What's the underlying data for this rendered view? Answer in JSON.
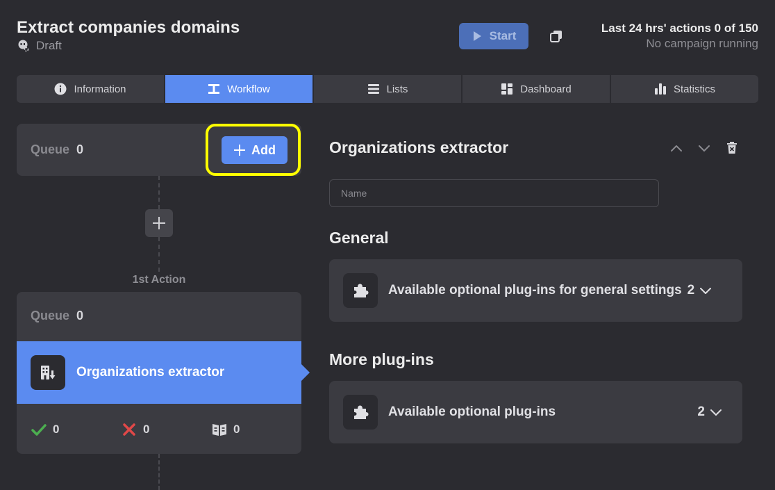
{
  "header": {
    "title": "Extract companies domains",
    "status": "Draft",
    "start_label": "Start",
    "actions_line1": "Last 24 hrs' actions 0 of 150",
    "actions_line2": "No campaign running"
  },
  "tabs": [
    {
      "label": "Information",
      "icon": "info-icon",
      "active": false
    },
    {
      "label": "Workflow",
      "icon": "workflow-icon",
      "active": true
    },
    {
      "label": "Lists",
      "icon": "list-icon",
      "active": false
    },
    {
      "label": "Dashboard",
      "icon": "dashboard-icon",
      "active": false
    },
    {
      "label": "Statistics",
      "icon": "bar-chart-icon",
      "active": false
    }
  ],
  "workflow": {
    "queue_label": "Queue",
    "queue_count": "0",
    "add_label": "Add",
    "action_caption": "1st Action",
    "action": {
      "queue_label": "Queue",
      "queue_count": "0",
      "name": "Organizations extractor",
      "success_count": "0",
      "error_count": "0",
      "skipped_count": "0"
    }
  },
  "panel": {
    "title": "Organizations extractor",
    "name_placeholder": "Name",
    "general_title": "General",
    "general_plugins_label": "Available optional plug-ins for general settings",
    "general_plugins_count": "2",
    "more_title": "More plug-ins",
    "more_plugins_label": "Available optional plug-ins",
    "more_plugins_count": "2"
  },
  "colors": {
    "background": "#2b2b30",
    "card": "#3b3b41",
    "accent": "#5b8bf0",
    "highlight": "#ffff00",
    "success": "#4caf50",
    "error": "#e04848"
  }
}
